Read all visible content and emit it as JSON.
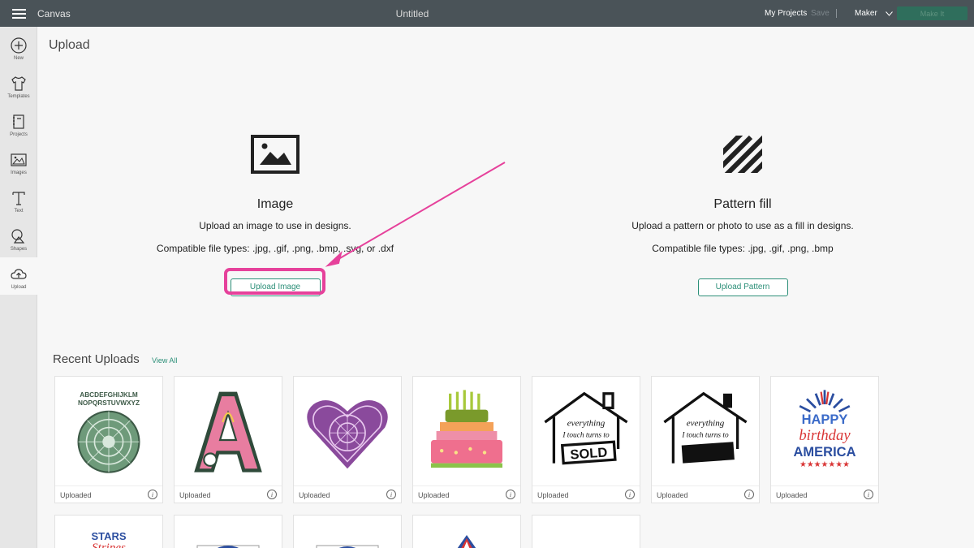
{
  "topbar": {
    "app_title": "Canvas",
    "doc_title": "Untitled",
    "my_projects": "My Projects",
    "save": "Save",
    "machine": "Maker",
    "make_it": "Make It"
  },
  "sidebar": {
    "items": [
      {
        "label": "New",
        "icon": "plus-circle-icon"
      },
      {
        "label": "Templates",
        "icon": "tshirt-icon"
      },
      {
        "label": "Projects",
        "icon": "notebook-icon"
      },
      {
        "label": "Images",
        "icon": "image-icon"
      },
      {
        "label": "Text",
        "icon": "text-t-icon"
      },
      {
        "label": "Shapes",
        "icon": "shapes-icon"
      },
      {
        "label": "Upload",
        "icon": "cloud-upload-icon"
      }
    ]
  },
  "page": {
    "title": "Upload"
  },
  "image_option": {
    "heading": "Image",
    "description": "Upload an image to use in designs.",
    "file_types": "Compatible file types: .jpg, .gif, .png, .bmp, .svg, or .dxf",
    "button": "Upload Image"
  },
  "pattern_option": {
    "heading": "Pattern fill",
    "description": "Upload a pattern or photo to use as a fill in designs.",
    "file_types": "Compatible file types: .jpg, .gif, .png, .bmp",
    "button": "Upload Pattern"
  },
  "recent": {
    "title": "Recent Uploads",
    "view_all": "View All",
    "items": [
      {
        "status": "Uploaded",
        "thumb": "alphabet-mandala",
        "text_top": "ABCDEFGHIJKLM",
        "text_bottom": "NOPQRSTUVWXYZ"
      },
      {
        "status": "Uploaded",
        "thumb": "letter-a-monogram",
        "text_top": "A"
      },
      {
        "status": "Uploaded",
        "thumb": "mandala-heart"
      },
      {
        "status": "Uploaded",
        "thumb": "birthday-cake"
      },
      {
        "status": "Uploaded",
        "thumb": "house-sold-sign",
        "text_top": "everything",
        "text_bottom": "I touch turns to",
        "text_sign": "SOLD"
      },
      {
        "status": "Uploaded",
        "thumb": "house-blank-sign",
        "text_top": "everything",
        "text_bottom": "I touch turns to"
      },
      {
        "status": "Uploaded",
        "thumb": "happy-birthday-america",
        "text_top": "HAPPY",
        "text_bottom": "birthday",
        "text_sign": "AMERICA"
      }
    ],
    "partial_items": [
      {
        "thumb": "stars-stripes",
        "text_top": "STARS",
        "text_bottom": "Stripes"
      },
      {
        "thumb": "flag-partial"
      },
      {
        "thumb": "flag-partial-2"
      },
      {
        "thumb": "triangle-flag"
      },
      {
        "thumb": "blank"
      }
    ]
  },
  "colors": {
    "topbar": "#4a5358",
    "accent": "#2c8f78",
    "highlight": "#e6419b"
  }
}
